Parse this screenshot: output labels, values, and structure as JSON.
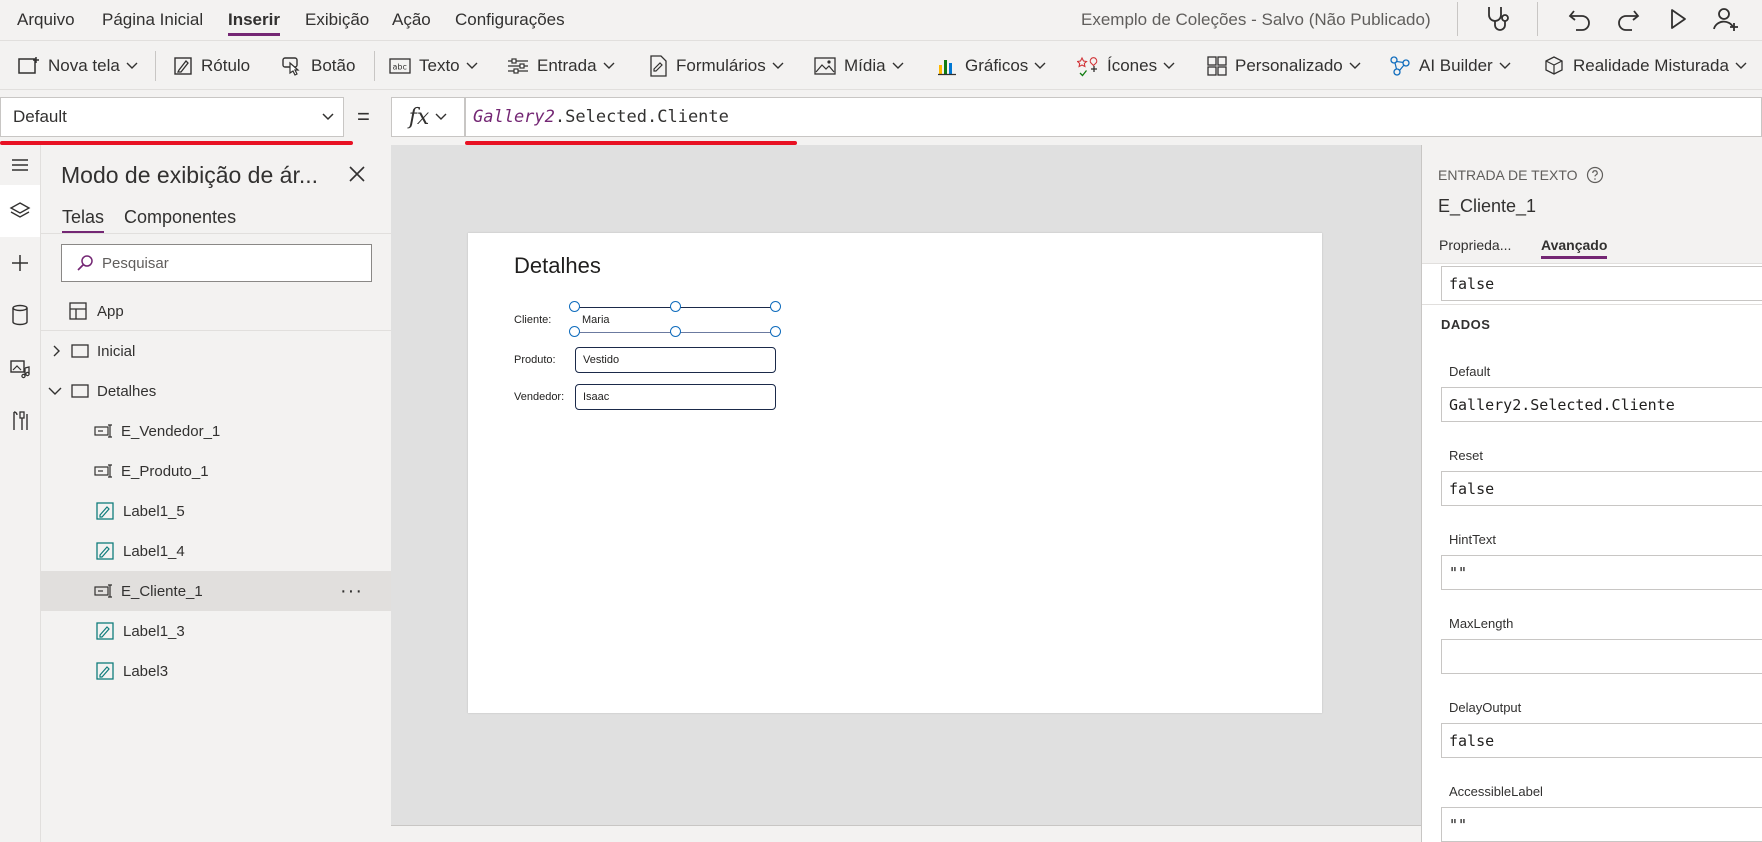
{
  "menu": {
    "items": [
      "Arquivo",
      "Página Inicial",
      "Inserir",
      "Exibição",
      "Ação",
      "Configurações"
    ],
    "active": "Inserir",
    "app_title": "Exemplo de Coleções - Salvo (Não Publicado)",
    "right_icons": [
      "app-checker-icon",
      "undo-icon",
      "redo-icon",
      "play-icon",
      "share-user-icon"
    ]
  },
  "ribbon": {
    "nova_tela": "Nova tela",
    "rotulo": "Rótulo",
    "botao": "Botão",
    "texto": "Texto",
    "entrada": "Entrada",
    "formularios": "Formulários",
    "midia": "Mídia",
    "graficos": "Gráficos",
    "icones": "Ícones",
    "personalizado": "Personalizado",
    "ai_builder": "AI Builder",
    "realidade_misturada": "Realidade Misturada"
  },
  "formula_bar": {
    "property": "Default",
    "equals": "=",
    "fx": "fx",
    "formula_gallery": "Gallery2",
    "formula_rest": ".Selected.Cliente"
  },
  "tree": {
    "title": "Modo de exibição de ár...",
    "tabs": [
      "Telas",
      "Componentes"
    ],
    "search_placeholder": "Pesquisar",
    "items": [
      {
        "label": "App"
      },
      {
        "label": "Inicial"
      },
      {
        "label": "Detalhes"
      },
      {
        "label": "E_Vendedor_1"
      },
      {
        "label": "E_Produto_1"
      },
      {
        "label": "Label1_5"
      },
      {
        "label": "Label1_4"
      },
      {
        "label": "E_Cliente_1"
      },
      {
        "label": "Label1_3"
      },
      {
        "label": "Label3"
      }
    ],
    "selected": "E_Cliente_1",
    "more": "···"
  },
  "canvas": {
    "screen_title": "Detalhes",
    "fields": [
      {
        "label": "Cliente:",
        "value": "Maria"
      },
      {
        "label": "Produto:",
        "value": "Vestido"
      },
      {
        "label": "Vendedor:",
        "value": "Isaac"
      }
    ]
  },
  "properties": {
    "control_type": "ENTRADA DE TEXTO",
    "control_name": "E_Cliente_1",
    "tabs": [
      "Proprieda...",
      "Avançado"
    ],
    "active_tab": "Avançado",
    "top_value": "false",
    "section": "DADOS",
    "rows": [
      {
        "name": "Default",
        "value": "Gallery2.Selected.Cliente"
      },
      {
        "name": "Reset",
        "value": "false"
      },
      {
        "name": "HintText",
        "value": "\"\""
      },
      {
        "name": "MaxLength",
        "value": ""
      },
      {
        "name": "DelayOutput",
        "value": "false"
      },
      {
        "name": "AccessibleLabel",
        "value": "\"\""
      }
    ]
  },
  "colors": {
    "accent": "#742774",
    "highlight_red": "#e81123",
    "selection_blue": "#0f6cbd"
  }
}
